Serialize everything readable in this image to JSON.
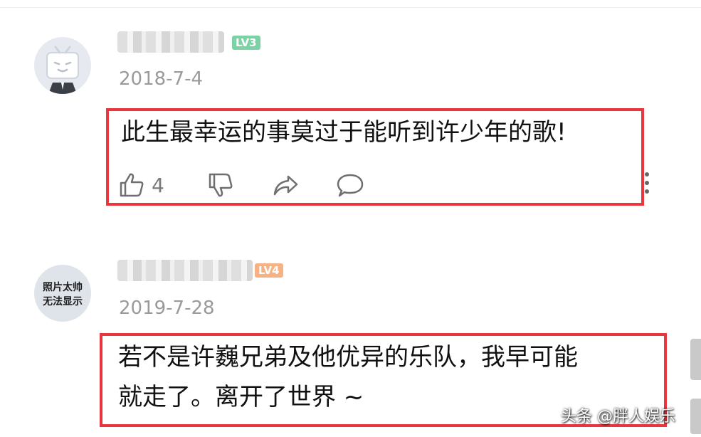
{
  "comments": [
    {
      "avatar": "tv-mascot-avatar",
      "level_badge": "LV3",
      "date": "2018-7-4",
      "text": "此生最幸运的事莫过于能听到许少年的歌!",
      "actions": {
        "like_count": "4",
        "like_icon": "thumbs-up-icon",
        "dislike_icon": "thumbs-down-icon",
        "share_icon": "share-icon",
        "reply_icon": "reply-icon",
        "more_icon": "more-vertical-icon"
      }
    },
    {
      "avatar_text": [
        "照片太帅",
        "无法显示"
      ],
      "level_badge": "LV4",
      "date": "2019-7-28",
      "text_lines": [
        "若不是许巍兄弟及他优异的乐队，我早可能",
        "就走了。离开了世界 ~"
      ]
    }
  ],
  "watermark": "头条 @胖人娱乐",
  "colors": {
    "highlight": "#e8353e",
    "date": "#9a9a9a",
    "level3": "#7bd3a5",
    "level4": "#f7b183"
  }
}
